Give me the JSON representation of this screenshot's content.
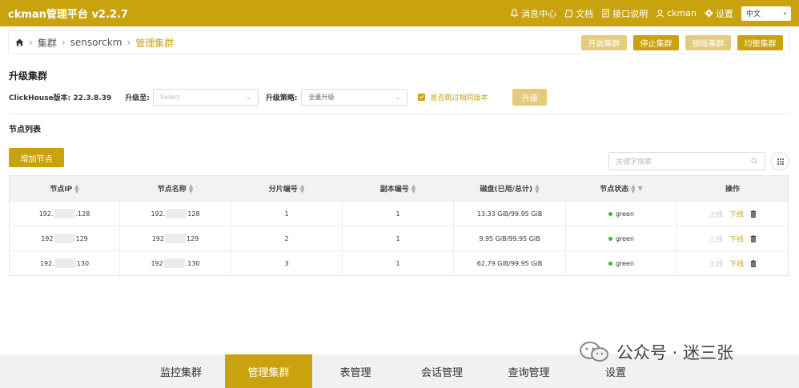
{
  "header": {
    "brand": "ckman管理平台 v2.2.7",
    "items": {
      "messages": "消息中心",
      "docs": "文档",
      "api": "接口说明",
      "user": "ckman",
      "settings": "设置"
    },
    "language": "中文"
  },
  "breadcrumb": {
    "items": [
      "集群",
      "sensorckm"
    ],
    "current": "管理集群"
  },
  "cluster_actions": {
    "start": "开启集群",
    "stop": "停止集群",
    "destroy": "销毁集群",
    "rebalance": "均衡集群"
  },
  "upgrade": {
    "title": "升级集群",
    "version_label": "ClickHouse版本: 22.3.8.39",
    "upgrade_to_label": "升级至:",
    "upgrade_to_placeholder": "Select",
    "strategy_label": "升级策略:",
    "strategy_value": "全量升级",
    "skip_same_label": "是否跳过相同版本",
    "skip_same_checked": true,
    "submit": "升级"
  },
  "node_list": {
    "title": "节点列表",
    "add_node": "增加节点",
    "search_placeholder": "关键字搜索",
    "columns": [
      "节点IP",
      "节点名称",
      "分片编号",
      "副本编号",
      "磁盘(已用/总计)",
      "节点状态",
      "操作"
    ],
    "rows": [
      {
        "ip_prefix": "192.",
        "ip_suffix": ".128",
        "name_prefix": "192.",
        "name_suffix": "128",
        "shard": "1",
        "replica": "1",
        "disk": "13.33 GiB/99.95 GiB",
        "status": "green",
        "online": "上线",
        "offline": "下线"
      },
      {
        "ip_prefix": "192",
        "ip_suffix": "129",
        "name_prefix": "192",
        "name_suffix": "129",
        "shard": "2",
        "replica": "1",
        "disk": "9.95 GiB/99.95 GiB",
        "status": "green",
        "online": "上线",
        "offline": "下线"
      },
      {
        "ip_prefix": "192.",
        "ip_suffix": "130",
        "name_prefix": "192",
        "name_suffix": ".130",
        "shard": "3",
        "replica": "1",
        "disk": "62.79 GiB/99.95 GiB",
        "status": "green",
        "online": "上线",
        "offline": "下线"
      }
    ]
  },
  "bottom_nav": {
    "items": [
      "监控集群",
      "管理集群",
      "表管理",
      "会话管理",
      "查询管理",
      "设置"
    ],
    "active": "管理集群"
  },
  "watermark": "公众号 · 迷三张",
  "colors": {
    "accent": "#c9a30e",
    "accent_light": "#e3cc7e",
    "status_green": "#2bbf3a"
  }
}
